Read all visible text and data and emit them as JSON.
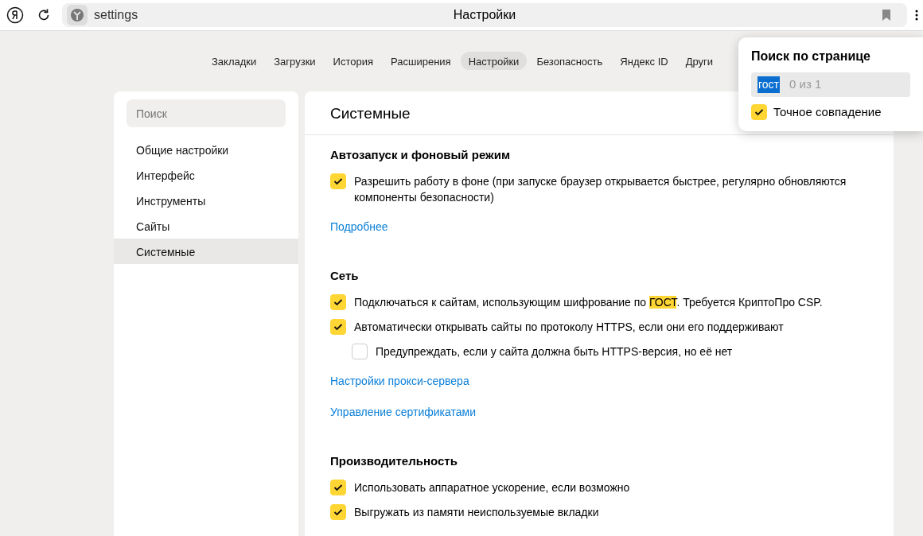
{
  "toolbar": {
    "address": "settings",
    "page_title": "Настройки"
  },
  "tabs": [
    {
      "label": "Закладки",
      "selected": false
    },
    {
      "label": "Загрузки",
      "selected": false
    },
    {
      "label": "История",
      "selected": false
    },
    {
      "label": "Расширения",
      "selected": false
    },
    {
      "label": "Настройки",
      "selected": true
    },
    {
      "label": "Безопасность",
      "selected": false
    },
    {
      "label": "Яндекс ID",
      "selected": false
    },
    {
      "label": "Други",
      "selected": false
    }
  ],
  "sidebar": {
    "search": {
      "placeholder": "Поиск"
    },
    "items": [
      {
        "label": "Общие настройки",
        "selected": false
      },
      {
        "label": "Интерфейс",
        "selected": false
      },
      {
        "label": "Инструменты",
        "selected": false
      },
      {
        "label": "Сайты",
        "selected": false
      },
      {
        "label": "Системные",
        "selected": true
      }
    ]
  },
  "content": {
    "title": "Системные",
    "sections": [
      {
        "heading": "Автозапуск и фоновый режим",
        "items": [
          {
            "kind": "checkbox",
            "checked": true,
            "nested": false,
            "parts": [
              {
                "text": "Разрешить работу в фоне (при запуске браузер открывается быстрее, регулярно обновляются компоненты безопасности)",
                "highlighted": false
              }
            ]
          },
          {
            "kind": "link",
            "label": "Подробнее"
          }
        ]
      },
      {
        "heading": "Сеть",
        "items": [
          {
            "kind": "checkbox",
            "checked": true,
            "nested": false,
            "parts": [
              {
                "text": "Подключаться к сайтам, использующим шифрование по ",
                "highlighted": false
              },
              {
                "text": "ГОСТ",
                "highlighted": true
              },
              {
                "text": ". Требуется КриптоПро CSP.",
                "highlighted": false
              }
            ]
          },
          {
            "kind": "checkbox",
            "checked": true,
            "nested": false,
            "parts": [
              {
                "text": "Автоматически открывать сайты по протоколу HTTPS, если они его поддерживают",
                "highlighted": false
              }
            ]
          },
          {
            "kind": "checkbox",
            "checked": false,
            "nested": true,
            "parts": [
              {
                "text": "Предупреждать, если у сайта должна быть HTTPS-версия, но её нет",
                "highlighted": false
              }
            ]
          },
          {
            "kind": "link",
            "label": "Настройки прокси-сервера"
          },
          {
            "kind": "link",
            "label": "Управление сертификатами"
          }
        ]
      },
      {
        "heading": "Производительность",
        "items": [
          {
            "kind": "checkbox",
            "checked": true,
            "nested": false,
            "parts": [
              {
                "text": "Использовать аппаратное ускорение, если возможно",
                "highlighted": false
              }
            ]
          },
          {
            "kind": "checkbox",
            "checked": true,
            "nested": false,
            "parts": [
              {
                "text": "Выгружать из памяти неиспользуемые вкладки",
                "highlighted": false
              }
            ]
          }
        ]
      }
    ]
  },
  "find_popup": {
    "title": "Поиск по странице",
    "query": "гост",
    "count": "0 из 1",
    "exact_match": {
      "label": "Точное совпадение",
      "checked": true
    }
  }
}
